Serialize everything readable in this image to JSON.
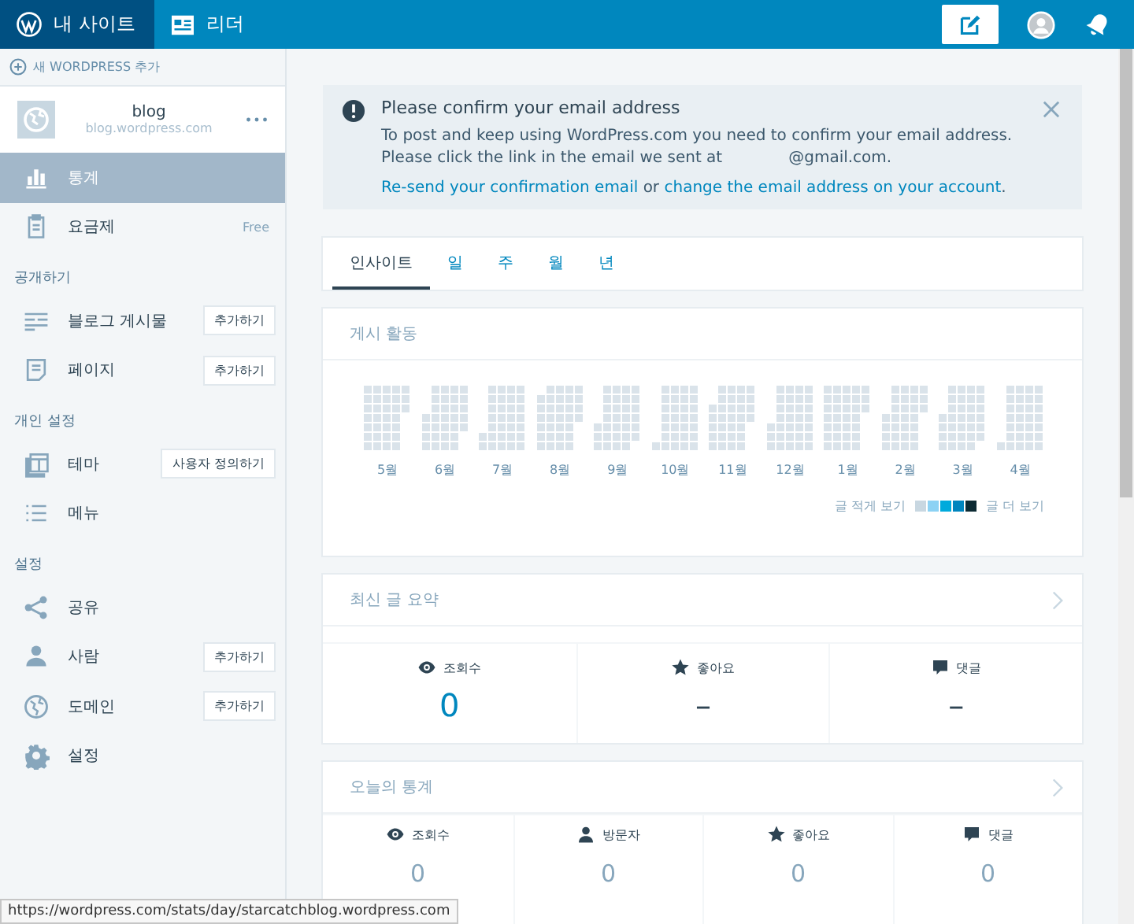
{
  "masterbar": {
    "my_site": {
      "label": "내 사이트",
      "selected": true
    },
    "reader": {
      "label": "리더",
      "selected": false
    }
  },
  "sidebar": {
    "add_site": "새 WORDPRESS 추가",
    "site": {
      "name": "blog",
      "url": "blog.wordpress.com"
    },
    "top_items": [
      {
        "label": "통계",
        "selected": true
      },
      {
        "label": "요금제",
        "badge": "Free",
        "selected": false
      }
    ],
    "sections": [
      {
        "title": "공개하기",
        "items": [
          {
            "label": "블로그 게시물",
            "action": "추가하기",
            "selected": false
          },
          {
            "label": "페이지",
            "action": "추가하기",
            "selected": false
          }
        ]
      },
      {
        "title": "개인 설정",
        "items": [
          {
            "label": "테마",
            "action": "사용자 정의하기",
            "selected": false
          },
          {
            "label": "메뉴",
            "selected": false
          }
        ]
      },
      {
        "title": "설정",
        "items": [
          {
            "label": "공유",
            "selected": false
          },
          {
            "label": "사람",
            "action": "추가하기",
            "selected": false
          },
          {
            "label": "도메인",
            "action": "추가하기",
            "selected": false
          },
          {
            "label": "설정",
            "selected": false
          }
        ]
      }
    ]
  },
  "notice": {
    "title": "Please confirm your email address",
    "body": "To post and keep using WordPress.com you need to confirm your email address. Please click the link in the email we sent at",
    "email": "@gmail.com.",
    "resend_link": "Re-send your confirmation email",
    "or": "or",
    "change_link": "change the email address on your account",
    "end": "."
  },
  "tabs": [
    {
      "label": "인사이트",
      "selected": true
    },
    {
      "label": "일",
      "selected": false
    },
    {
      "label": "주",
      "selected": false
    },
    {
      "label": "월",
      "selected": false
    },
    {
      "label": "년",
      "selected": false
    }
  ],
  "post_activity": {
    "title": "게시 활동",
    "months": [
      "5월",
      "6월",
      "7월",
      "8월",
      "9월",
      "10월",
      "11월",
      "12월",
      "1월",
      "2월",
      "3월",
      "4월"
    ],
    "legend_less": "글 적게 보기",
    "legend_more": "글 더 보기"
  },
  "latest_post_summary": {
    "title": "최신 글 요약",
    "stats": [
      {
        "kind": "views",
        "label": "조회수",
        "value": "0"
      },
      {
        "kind": "likes",
        "label": "좋아요",
        "value": "–"
      },
      {
        "kind": "comments",
        "label": "댓글",
        "value": "–"
      }
    ]
  },
  "todays_stats": {
    "title": "오늘의 통계",
    "stats": [
      {
        "kind": "views",
        "label": "조회수",
        "value": "0"
      },
      {
        "kind": "visitors",
        "label": "방문자",
        "value": "0"
      },
      {
        "kind": "likes",
        "label": "좋아요",
        "value": "0"
      },
      {
        "kind": "comments",
        "label": "댓글",
        "value": "0"
      }
    ]
  },
  "status_url": "https://wordpress.com/stats/day/starcatchblog.wordpress.com"
}
